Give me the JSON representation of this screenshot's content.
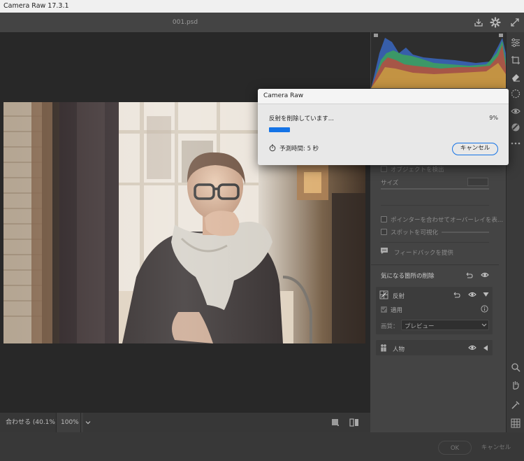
{
  "window": {
    "title": "Camera Raw 17.3.1"
  },
  "header": {
    "filename": "001.psd"
  },
  "dialog": {
    "title": "Camera Raw",
    "message": "反射を削除しています...",
    "percent_label": "9%",
    "progress": 0.09,
    "eta_label": "予測時間: 5 秒",
    "cancel_label": "キャンセル"
  },
  "panel": {
    "detect_objects_label": "オブジェクトを検出",
    "size_label": "サイズ",
    "overlay_label": "ポインターを合わせてオーバーレイを表...",
    "visualize_spots_label": "スポットを可視化",
    "feedback_label": "フィードバックを提供",
    "distractions_title": "気になる箇所の削除",
    "reflections_label": "反射",
    "apply_label": "適用",
    "quality_label": "画質：",
    "quality_value": "プレビュー",
    "people_label": "人物"
  },
  "zoom": {
    "fit_label": "合わせる (40.1%)",
    "percent_label": "100%"
  },
  "footer": {
    "ok_label": "OK",
    "cancel_label": "キャンセル"
  },
  "colors": {
    "accent": "#1473e6",
    "panel": "#444444",
    "canvas": "#282828"
  }
}
